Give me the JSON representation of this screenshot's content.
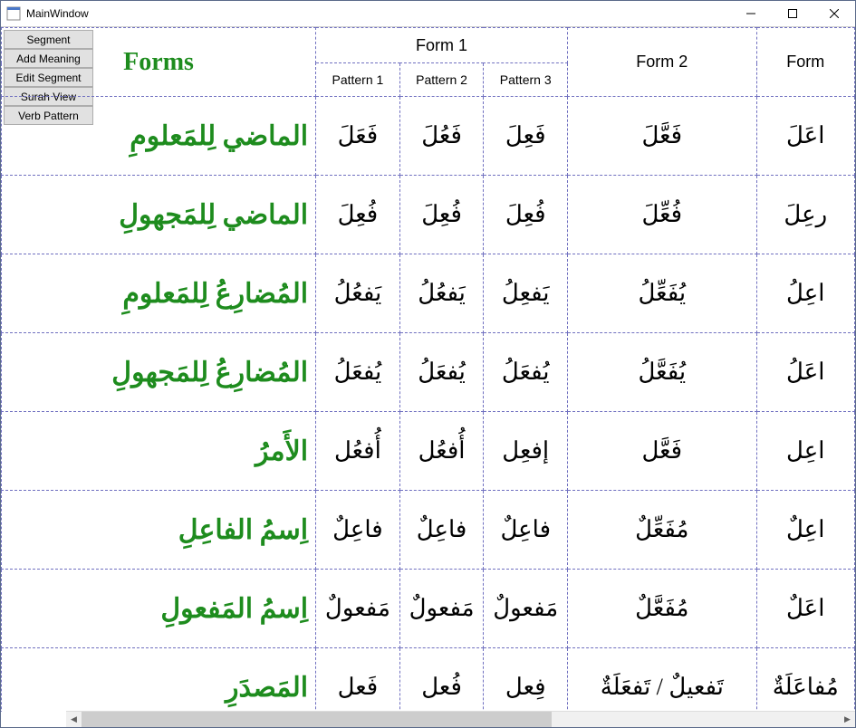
{
  "window": {
    "title": "MainWindow"
  },
  "sidebar": {
    "buttons": [
      "Segment",
      "Add Meaning",
      "Edit Segment",
      "Surah View",
      "Verb Pattern"
    ]
  },
  "table": {
    "corner": "Forms",
    "formGroups": [
      "Form 1",
      "Form 2",
      "Form"
    ],
    "patterns": [
      "Pattern 1",
      "Pattern 2",
      "Pattern 3"
    ],
    "rows": [
      {
        "label": "الماضي لِلمَعلومِ",
        "p1": "فَعَلَ",
        "p2": "فَعُلَ",
        "p3": "فَعِلَ",
        "f2": "فَعَّلَ",
        "f3": "اعَلَ"
      },
      {
        "label": "الماضي لِلمَجهولِ",
        "p1": "فُعِلَ",
        "p2": "فُعِلَ",
        "p3": "فُعِلَ",
        "f2": "فُعِّلَ",
        "f3": "رعِلَ"
      },
      {
        "label": "المُضارِعُ لِلمَعلومِ",
        "p1": "يَفعُلُ",
        "p2": "يَفعُلُ",
        "p3": "يَفعِلُ",
        "f2": "يُفَعِّلُ",
        "f3": "اعِلُ"
      },
      {
        "label": "المُضارِعُ لِلمَجهولِ",
        "p1": "يُفعَلُ",
        "p2": "يُفعَلُ",
        "p3": "يُفعَلُ",
        "f2": "يُفَعَّلُ",
        "f3": "اعَلُ"
      },
      {
        "label": "الأَمرُ",
        "p1": "أُفعُل",
        "p2": "أُفعُل",
        "p3": "إفعِل",
        "f2": "فَعَّل",
        "f3": "اعِل"
      },
      {
        "label": "اِسمُ الفاعِلِ",
        "p1": "فاعِلٌ",
        "p2": "فاعِلٌ",
        "p3": "فاعِلٌ",
        "f2": "مُفَعِّلٌ",
        "f3": "اعِلٌ"
      },
      {
        "label": "اِسمُ المَفعولِ",
        "p1": "مَفعولٌ",
        "p2": "مَفعولٌ",
        "p3": "مَفعولٌ",
        "f2": "مُفَعَّلٌ",
        "f3": "اعَلٌ"
      },
      {
        "label": "المَصدَرِ",
        "p1": "فَعل",
        "p2": "فُعل",
        "p3": "فِعل",
        "f2": "تَفعيلٌ / تَفعَلَةٌ",
        "f3": "مُفاعَلَةٌ"
      }
    ]
  }
}
